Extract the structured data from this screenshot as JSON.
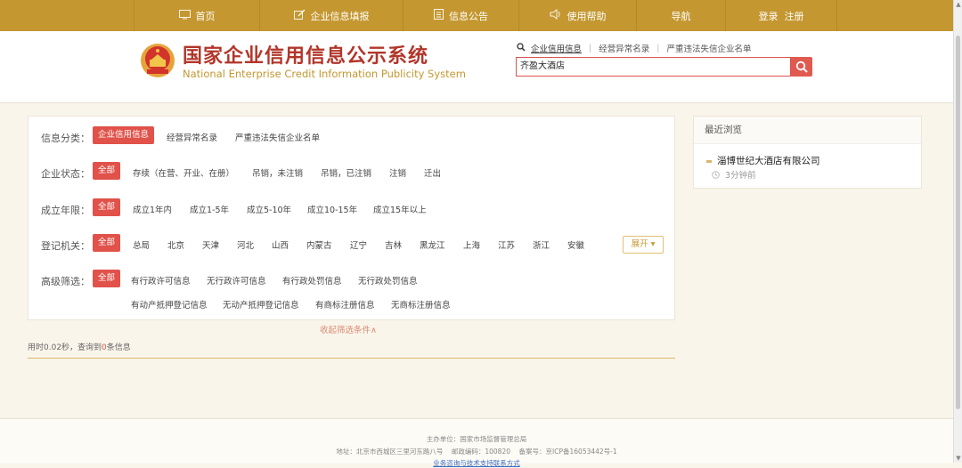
{
  "nav": {
    "items": [
      {
        "label": "首页",
        "icon": "monitor-icon"
      },
      {
        "label": "企业信息填报",
        "icon": "edit-icon"
      },
      {
        "label": "信息公告",
        "icon": "document-icon"
      },
      {
        "label": "使用帮助",
        "icon": "speaker-icon"
      },
      {
        "label": "导航",
        "icon": ""
      },
      {
        "label": "登录  注册",
        "icon": ""
      }
    ]
  },
  "header": {
    "title": "国家企业信用信息公示系统",
    "subtitle": "National Enterprise Credit Information Publicity System"
  },
  "search": {
    "tabs": [
      "企业信用信息",
      "经营异常名录",
      "严重违法失信企业名单"
    ],
    "value": "齐盈大酒店"
  },
  "filters": {
    "category": {
      "label": "信息分类：",
      "options": [
        "企业信用信息",
        "经营异常名录",
        "严重违法失信企业名单"
      ]
    },
    "status": {
      "label": "企业状态：",
      "options": [
        "全部",
        "存续（在营、开业、在册）",
        "吊销，未注销",
        "吊销，已注销",
        "注销",
        "迁出"
      ]
    },
    "years": {
      "label": "成立年限：",
      "options": [
        "全部",
        "成立1年内",
        "成立1-5年",
        "成立5-10年",
        "成立10-15年",
        "成立15年以上"
      ]
    },
    "authority": {
      "label": "登记机关：",
      "options": [
        "全部",
        "总局",
        "北京",
        "天津",
        "河北",
        "山西",
        "内蒙古",
        "辽宁",
        "吉林",
        "黑龙江",
        "上海",
        "江苏",
        "浙江",
        "安徽"
      ],
      "expand_label": "展开 ▾"
    },
    "advanced": {
      "label": "高级筛选：",
      "options": [
        "全部",
        "有行政许可信息",
        "无行政许可信息",
        "有行政处罚信息",
        "无行政处罚信息",
        "有动产抵押登记信息",
        "无动产抵押登记信息",
        "有商标注册信息",
        "无商标注册信息"
      ]
    },
    "collapse_label": "收起筛选条件∧"
  },
  "result": {
    "prefix": "用时0.02秒，查询到",
    "count": "0",
    "suffix": "条信息"
  },
  "recent": {
    "title": "最近浏览",
    "company": "淄博世纪大酒店有限公司",
    "time": "3分钟前"
  },
  "footer": {
    "line1": "主办单位：国家市场监督管理总局",
    "line2": "地址：北京市西城区三里河东路八号    邮政编码：100820    备案号：京ICP备16053442号-1",
    "line3": "业务咨询与技术支持联系方式"
  },
  "colors": {
    "nav_bg": "#c49730",
    "accent_red": "#e0524a",
    "title_red": "#b2362a"
  }
}
